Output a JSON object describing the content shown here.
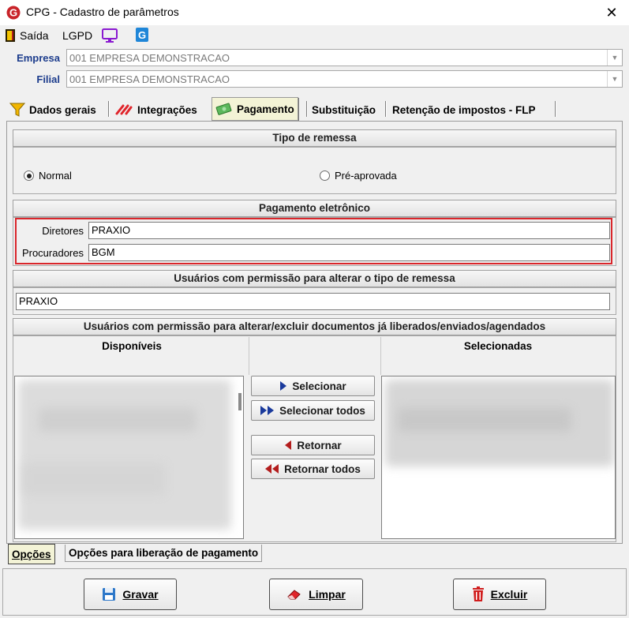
{
  "window": {
    "title": "CPG - Cadastro de parâmetros",
    "close_symbol": "✕"
  },
  "toolbar": {
    "exit_label": "Saída",
    "lgpd_label": "LGPD"
  },
  "filters": {
    "empresa_label": "Empresa",
    "empresa_value": "001 EMPRESA DEMONSTRACAO",
    "filial_label": "Filial",
    "filial_value": "001 EMPRESA DEMONSTRACAO"
  },
  "tabs": [
    {
      "label": "Dados gerais",
      "icon": "funnel-icon"
    },
    {
      "label": "Integrações",
      "icon": "integration-icon"
    },
    {
      "label": "Pagamento",
      "icon": "money-icon",
      "active": true
    },
    {
      "label": "Substituição"
    },
    {
      "label": "Retenção de impostos - FLP"
    }
  ],
  "tipo_remessa": {
    "title": "Tipo de remessa",
    "options": [
      {
        "label": "Normal",
        "selected": true
      },
      {
        "label": "Pré-aprovada",
        "selected": false
      }
    ]
  },
  "pagamento_eletronico": {
    "title": "Pagamento eletrônico",
    "diretores_label": "Diretores",
    "diretores_value": "PRAXIO",
    "procuradores_label": "Procuradores",
    "procuradores_value": "BGM",
    "highlight_color": "#d9262b"
  },
  "usuarios_tipo_remessa": {
    "title": "Usuários com permissão para alterar o tipo de remessa",
    "value": "PRAXIO"
  },
  "usuarios_documentos": {
    "title": "Usuários com permissão para alterar/excluir documentos já liberados/enviados/agendados",
    "available_header": "Disponíveis",
    "selected_header": "Selecionadas",
    "buttons": {
      "select": "Selecionar",
      "select_all": "Selecionar todos",
      "return": "Retornar",
      "return_all": "Retornar todos"
    }
  },
  "bottom_tabs": [
    {
      "label": "Opções",
      "active": true
    },
    {
      "label": "Opções para liberação de pagamento"
    }
  ],
  "actions": {
    "save_label": "Gravar",
    "clear_label": "Limpar",
    "delete_label": "Excluir"
  }
}
